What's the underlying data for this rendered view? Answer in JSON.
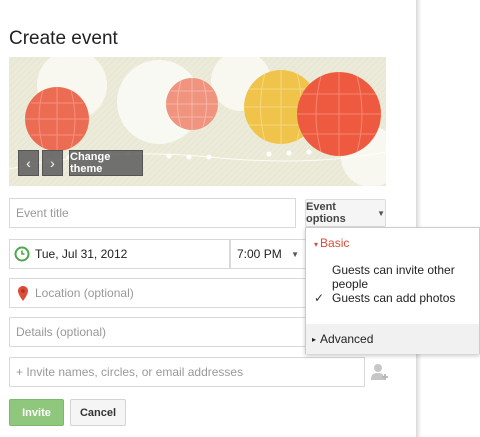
{
  "title": "Create event",
  "banner": {
    "prev_icon": "chevron-left",
    "next_icon": "chevron-right",
    "change_theme_label": "Change theme"
  },
  "event_title": {
    "placeholder": "Event title"
  },
  "event_options": {
    "label": "Event options"
  },
  "date": {
    "value": "Tue, Jul 31, 2012",
    "icon": "clock-icon"
  },
  "time": {
    "value": "7:00 PM"
  },
  "location": {
    "placeholder": "Location (optional)",
    "icon": "location-pin-icon"
  },
  "details": {
    "placeholder": "Details (optional)"
  },
  "invite": {
    "placeholder": "+ Invite names, circles, or email addresses",
    "icon": "add-person-icon"
  },
  "menu": {
    "basic_label": "Basic",
    "items": [
      {
        "label": "Guests can invite other people",
        "checked": false
      },
      {
        "label": "Guests can add photos",
        "checked": true
      }
    ],
    "advanced_label": "Advanced"
  },
  "buttons": {
    "invite": "Invite",
    "cancel": "Cancel"
  },
  "colors": {
    "invite_button": "#8fc77c",
    "basic_red": "#dd4b39"
  }
}
